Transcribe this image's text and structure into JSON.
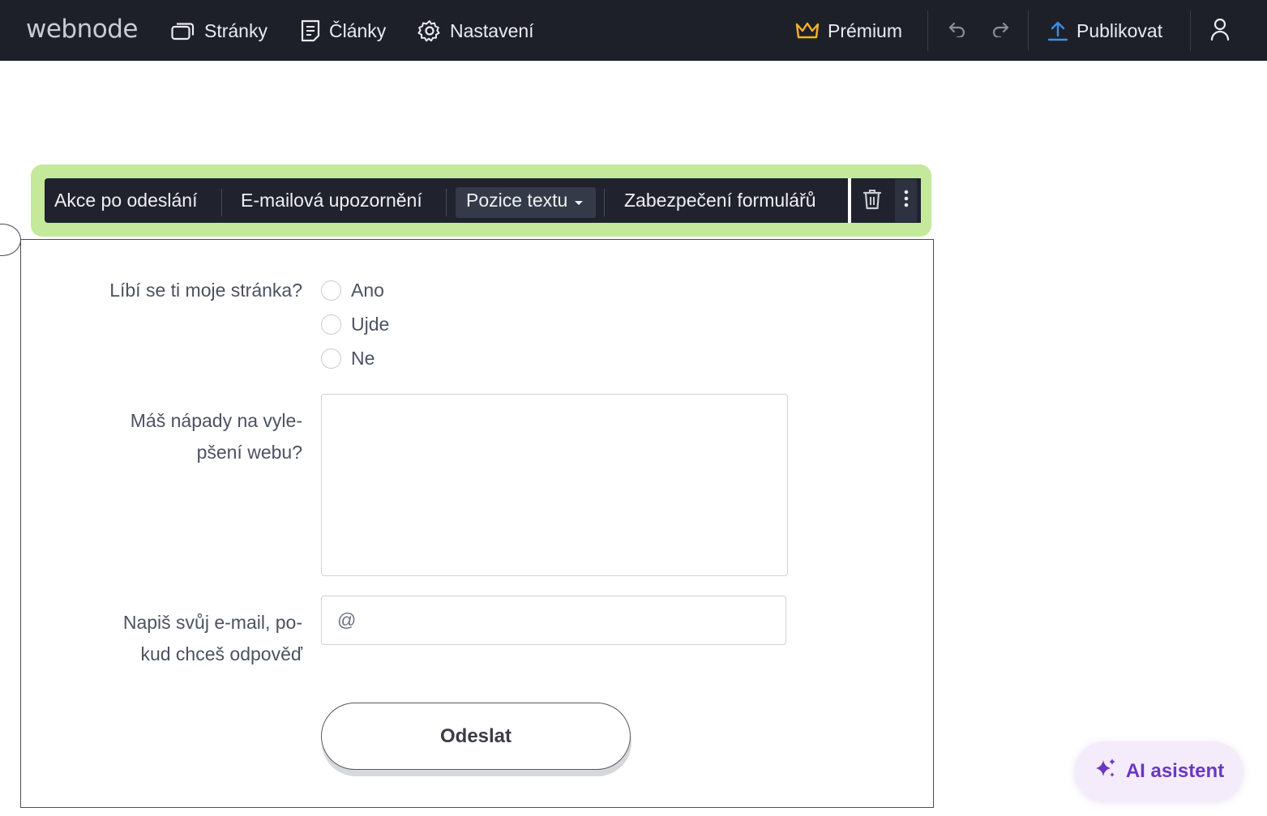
{
  "topbar": {
    "logo": "webnode",
    "nav": [
      {
        "label": "Stránky",
        "icon": "pages-icon"
      },
      {
        "label": "Články",
        "icon": "articles-icon"
      },
      {
        "label": "Nastavení",
        "icon": "gear-icon"
      }
    ],
    "premium_label": "Prémium",
    "publish_label": "Publikovat",
    "colors": {
      "background": "#1e2029",
      "premium_crown": "#f0b429",
      "publish_arrow": "#3b8ee8"
    }
  },
  "toolbar": {
    "items": [
      {
        "label": "Akce po odeslání"
      },
      {
        "label": "E-mailová upozornění"
      },
      {
        "label": "Pozice textu",
        "dropdown": true,
        "active": true
      },
      {
        "label": "Zabezpečení formulářů"
      }
    ],
    "highlight_color": "#c4e99b"
  },
  "form": {
    "question1": {
      "label": "Líbí se ti moje stránka?",
      "options": [
        "Ano",
        "Ujde",
        "Ne"
      ]
    },
    "question2": {
      "label_line1": "Máš nápady na vyle-",
      "label_line2": "pšení webu?",
      "value": ""
    },
    "question3": {
      "label_line1": "Napiš svůj e-mail, po-",
      "label_line2": "kud chceš odpověď",
      "placeholder": "@"
    },
    "submit_label": "Odeslat"
  },
  "ai_assistant": {
    "label": "AI asistent",
    "color": "#6b38c0"
  }
}
